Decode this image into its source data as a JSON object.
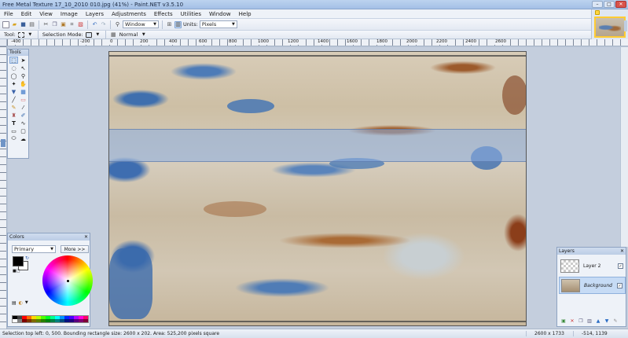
{
  "window": {
    "title": "Free Metal Texture 17_10_2010 010.jpg (41%) - Paint.NET v3.5.10"
  },
  "menu": [
    "File",
    "Edit",
    "View",
    "Image",
    "Layers",
    "Adjustments",
    "Effects",
    "Utilities",
    "Window",
    "Help"
  ],
  "toolbar": {
    "zoom_value": "Window",
    "units_label": "Units:",
    "units_value": "Pixels",
    "tool_label": "Tool:",
    "selection_mode_label": "Selection Mode:",
    "blend_mode": "Normal"
  },
  "rulers": {
    "h_labels": [
      "-400",
      "-200",
      "0",
      "200",
      "400",
      "600",
      "800",
      "1000",
      "1200",
      "1400",
      "1600",
      "1800",
      "2000",
      "2200",
      "2400",
      "2600"
    ]
  },
  "tools_panel": {
    "title": "Tools",
    "icons": [
      "rectangle-select-icon",
      "move-icon",
      "lasso-icon",
      "move-selection-icon",
      "ellipse-select-icon",
      "zoom-icon",
      "magic-wand-icon",
      "pan-icon",
      "paint-bucket-icon",
      "gradient-icon",
      "paintbrush-icon",
      "eraser-icon",
      "pencil-icon",
      "color-picker-icon",
      "clone-stamp-icon",
      "recolor-icon",
      "text-icon",
      "line-curve-icon",
      "rectangle-icon",
      "rounded-rectangle-icon",
      "ellipse-icon",
      "freeform-shape-icon"
    ]
  },
  "colors_panel": {
    "title": "Colors",
    "mode": "Primary",
    "more_label": "More >>",
    "primary_color": "#000000",
    "secondary_color": "#ffffff",
    "palette": [
      "#000000",
      "#404040",
      "#ff0000",
      "#ff6a00",
      "#ffd800",
      "#b6ff00",
      "#4cff00",
      "#00ff21",
      "#00ff90",
      "#00ffff",
      "#0094ff",
      "#0026ff",
      "#4800ff",
      "#b200ff",
      "#ff00dc",
      "#ff006e",
      "#ffffff",
      "#808080",
      "#7f0000",
      "#7f3300",
      "#7f6a00",
      "#5b7f00",
      "#267f00",
      "#007f0e",
      "#007f46",
      "#007f7f",
      "#004a7f",
      "#00137f",
      "#21007f",
      "#57007f",
      "#7f006e",
      "#7f0037"
    ]
  },
  "layers_panel": {
    "title": "Layers",
    "layers": [
      {
        "name": "Layer 2",
        "visible": true,
        "selected": false
      },
      {
        "name": "Background",
        "visible": true,
        "selected": true
      }
    ]
  },
  "status": {
    "message": "Selection top left: 0, 500. Bounding rectangle size: 2600 x 202. Area: 525,200 pixels square",
    "image_size": "2600 x 1733",
    "cursor": "-514, 1139"
  }
}
